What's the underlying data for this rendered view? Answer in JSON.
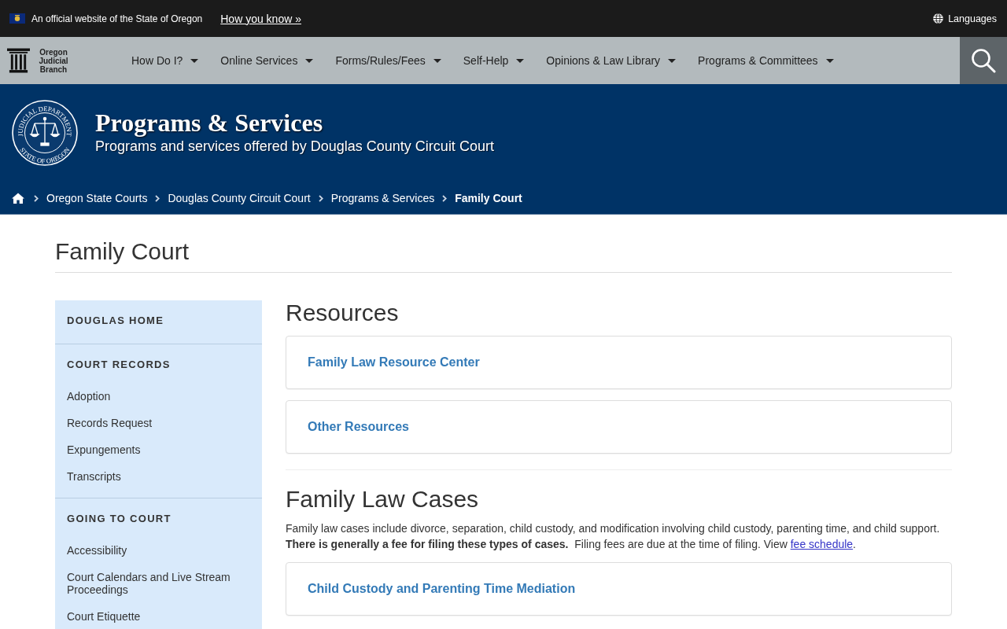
{
  "gov_banner": {
    "notice": "An official website of the State of Oregon",
    "link": "How you know »",
    "languages": "Languages"
  },
  "site_nav": {
    "brand": "Oregon Judicial Branch",
    "items": [
      "How Do I?",
      "Online Services",
      "Forms/Rules/Fees",
      "Self-Help",
      "Opinions & Law Library",
      "Programs & Committees"
    ]
  },
  "page_header": {
    "seal": {
      "top_text": "JUDICIAL DEPARTMENT",
      "bottom_text": "STATE OF OREGON"
    },
    "title": "Programs & Services",
    "subtitle": "Programs and services offered by Douglas County Circuit Court",
    "breadcrumb": [
      {
        "label": "Oregon State Courts",
        "current": false
      },
      {
        "label": "Douglas County Circuit Court",
        "current": false
      },
      {
        "label": "Programs & Services",
        "current": false
      },
      {
        "label": "Family Court",
        "current": true
      }
    ]
  },
  "page_title": "Family Court",
  "sidebar": {
    "sections": [
      {
        "heading": "DOUGLAS HOME"
      },
      {
        "heading": "COURT RECORDS",
        "items": [
          "Adoption",
          "Records Request",
          "Expungements",
          "Transcripts"
        ]
      },
      {
        "heading": "GOING TO COURT",
        "items": [
          "Accessibility",
          "Court Calendars and Live Stream Proceedings",
          "Court Etiquette"
        ]
      }
    ]
  },
  "content": {
    "sections": [
      {
        "heading": "Resources",
        "cards": [
          "Family Law Resource Center",
          "Other Resources"
        ]
      },
      {
        "heading": "Family Law Cases",
        "intro": {
          "text": "Family law cases include divorce, separation, child custody, and modification involving child custody, parenting time, and child support. **There is generally a fee for filing these types of cases.**  Filing fees are due at the time of filing. View",
          "link": "fee schedule",
          "after": "."
        },
        "cards": [
          "Child Custody and Parenting Time Mediation"
        ]
      }
    ]
  }
}
